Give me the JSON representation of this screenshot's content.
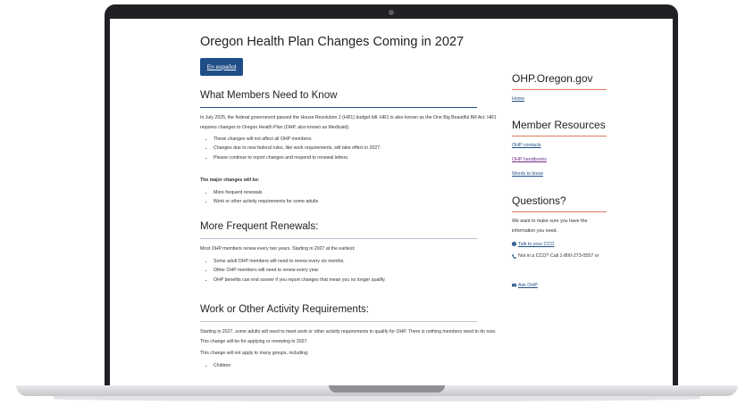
{
  "page": {
    "title": "Oregon Health Plan Changes Coming in 2027",
    "espanol_button": "En español"
  },
  "members": {
    "heading": "What Members Need to Know",
    "intro": "In July 2025, the federal government passed the House Resolution 1 (HR1) budget bill. HR1 is also known as the One Big Beautiful Bill Act. HR1 requires changes to Oregon Health Plan (OHP, also known as Medicaid).",
    "bullets": [
      "These changes will not affect all OHP members.",
      "Changes due to new federal rules, like work requirements, will take effect in 2027.",
      "Please continue to report changes and respond to renewal letters."
    ],
    "major_label": "The major changes will be:",
    "major_bullets": [
      "More frequent renewals",
      "Work or other activity requirements for some adults"
    ]
  },
  "renewals": {
    "heading": "More Frequent Renewals:",
    "intro": "Most OHP members renew every two years. Starting in 2027 at the earliest:",
    "bullets": [
      "Some adult OHP members will need to renew every six months.",
      "Other OHP members will need to renew every year.",
      "OHP benefits can end sooner if you report changes that mean you no longer qualify."
    ]
  },
  "work": {
    "heading": "Work or Other Activity Requirements:",
    "intro": "Starting in 2027, some adults will need to meet work or other activity requirements to qualify for OHP. There is nothing members need to do now. This change will be for applying or renewing in 2027.",
    "groups_label": "This change will not apply to many groups, including:",
    "bullets": [
      "Children"
    ]
  },
  "sidebar": {
    "site_title": "OHP.Oregon.gov",
    "home_link": "Home",
    "resources_heading": "Member Resources",
    "resources_links": [
      "OHP contacts",
      "OHP handbooks",
      "Words to know"
    ],
    "questions_heading": "Questions?",
    "questions_text": "We want to make sure you have the information you need.",
    "talk_link": "Talk to your CCO",
    "phone_text": "Not in a CCO? Call 1-800-273-0557 or",
    "ask_link": "Ask OHP"
  },
  "colors": {
    "accent_blue": "#1f4e87",
    "sidebar_rule": "#e07a5f",
    "visited_link": "#6b2b8a"
  }
}
